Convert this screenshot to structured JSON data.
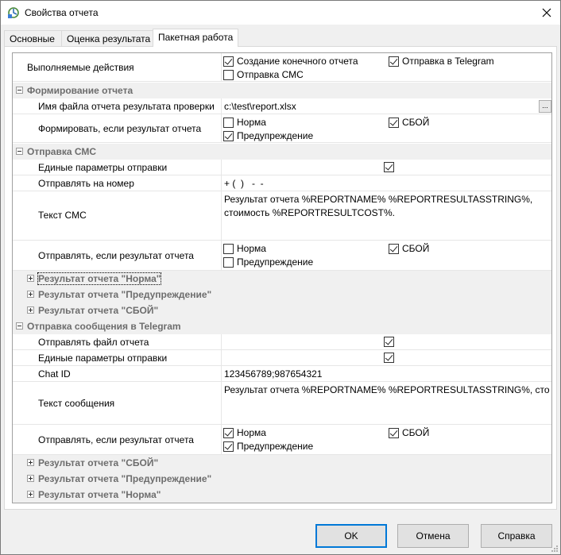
{
  "window": {
    "title": "Свойства отчета"
  },
  "tabs": [
    {
      "label": "Основные"
    },
    {
      "label": "Оценка результата"
    },
    {
      "label": "Пакетная работа"
    }
  ],
  "rows": {
    "actions": {
      "label": "Выполняемые действия",
      "options": [
        {
          "label": "Создание конечного отчета",
          "checked": true
        },
        {
          "label": "Отправка в Telegram",
          "checked": true
        },
        {
          "label": "Отправка СМС",
          "checked": false
        }
      ]
    },
    "report_group": {
      "label": "Формирование отчета",
      "file_name": {
        "label": "Имя файла отчета результата проверки",
        "value": "c:\\test\\report.xlsx",
        "button": "..."
      },
      "generate_if": {
        "label": "Формировать, если результат отчета",
        "options": [
          {
            "label": "Норма",
            "checked": false
          },
          {
            "label": "СБОЙ",
            "checked": true
          },
          {
            "label": "Предупреждение",
            "checked": true
          }
        ]
      }
    },
    "sms_group": {
      "label": "Отправка СМС",
      "common_params": {
        "label": "Единые параметры отправки",
        "checked": true
      },
      "send_to": {
        "label": "Отправлять на номер",
        "value": "+ (  )   -  -"
      },
      "sms_text": {
        "label": "Текст СМС",
        "value": "Результат отчета %REPORTNAME% %REPORTRESULTASSTRING%, стоимость %REPORTRESULTCOST%."
      },
      "send_if": {
        "label": "Отправлять, если результат отчета",
        "options": [
          {
            "label": "Норма",
            "checked": false
          },
          {
            "label": "СБОЙ",
            "checked": true
          },
          {
            "label": "Предупреждение",
            "checked": false
          }
        ]
      },
      "sub_norm": "Результат отчета \"Норма\"",
      "sub_warning": "Результат отчета \"Предупреждение\"",
      "sub_fail": "Результат отчета \"СБОЙ\""
    },
    "telegram_group": {
      "label": "Отправка сообщения в Telegram",
      "send_file": {
        "label": "Отправлять файл отчета",
        "checked": true
      },
      "common_params": {
        "label": "Единые параметры отправки",
        "checked": true
      },
      "chat_id": {
        "label": "Chat ID",
        "value": "123456789;987654321"
      },
      "message_text": {
        "label": "Текст сообщения",
        "value": "Результат отчета %REPORTNAME% %REPORTRESULTASSTRING%, стоимость %"
      },
      "send_if": {
        "label": "Отправлять, если результат отчета",
        "options": [
          {
            "label": "Норма",
            "checked": true
          },
          {
            "label": "СБОЙ",
            "checked": true
          },
          {
            "label": "Предупреждение",
            "checked": true
          }
        ]
      },
      "sub_fail": "Результат отчета \"СБОЙ\"",
      "sub_warning": "Результат отчета \"Предупреждение\"",
      "sub_norm": "Результат отчета \"Норма\""
    }
  },
  "buttons": {
    "ok": "OK",
    "cancel": "Отмена",
    "help": "Справка"
  }
}
